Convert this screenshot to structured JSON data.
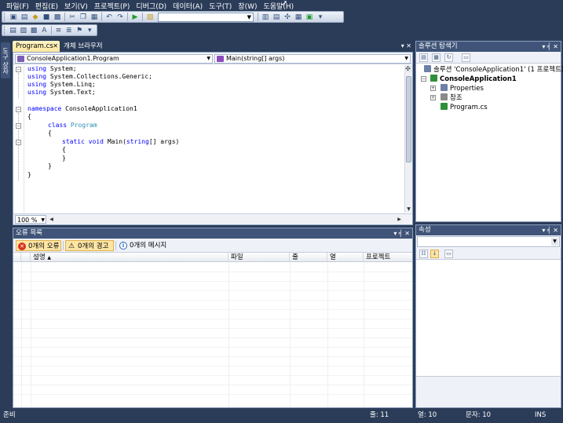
{
  "menu": [
    "파일(F)",
    "편집(E)",
    "보기(V)",
    "프로젝트(P)",
    "디버그(D)",
    "데이터(A)",
    "도구(T)",
    "창(W)",
    "도움말(H)"
  ],
  "toolbar": {
    "config_value": "",
    "icons": [
      "new-project-icon",
      "add-item-icon",
      "open-file-icon",
      "save-icon",
      "save-all-icon",
      "cut-icon",
      "copy-icon",
      "paste-icon",
      "undo-icon",
      "redo-icon",
      "start-debug-icon",
      "find-icon"
    ]
  },
  "left_strip": {
    "toolbox_label": "도구 상자"
  },
  "doc_tabs": {
    "active": "Program.cs",
    "close": "✕",
    "other": "개체 브라우저"
  },
  "nav": {
    "class_combo": "ConsoleApplication1.Program",
    "member_combo": "Main(string[] args)"
  },
  "code": {
    "l1": {
      "kw": "using",
      "rest": " System;"
    },
    "l2": {
      "kw": "using",
      "rest": " System.Collections.Generic;"
    },
    "l3": {
      "kw": "using",
      "rest": " System.Linq;"
    },
    "l4": {
      "kw": "using",
      "rest": " System.Text;"
    },
    "l6": {
      "kw": "namespace",
      "rest": " ConsoleApplication1"
    },
    "l7": "{",
    "l8": {
      "kw": "class",
      "ty": "Program"
    },
    "l9": "{",
    "l10": {
      "kw1": "static",
      "kw2": "void",
      "rest1": " Main(",
      "kw3": "string",
      "rest2": "[] args)"
    },
    "l11": "{",
    "l12": "}",
    "l13": "}",
    "l14": "}"
  },
  "zoom": "100 %",
  "error_list": {
    "title": "오류 목록",
    "errors": "0개의 오류",
    "warnings": "0개의 경고",
    "messages": "0개의 메시지",
    "columns": [
      "설명",
      "파일",
      "줄",
      "열",
      "프로젝트"
    ]
  },
  "solution_explorer": {
    "title": "솔루션 탐색기",
    "solution": "솔루션 'ConsoleApplication1' (1 프로젝트)",
    "project": "ConsoleApplication1",
    "items": [
      "Properties",
      "참조",
      "Program.cs"
    ]
  },
  "properties": {
    "title": "속성"
  },
  "panel_controls": "▾ ╡ ✕",
  "status": {
    "ready": "준비",
    "line": "줄: 11",
    "col": "열: 10",
    "char": "문자: 10",
    "mode": "INS"
  },
  "colors": {
    "keyword": "#0000ff",
    "type": "#2b91af",
    "chrome": "#2b3c59",
    "tab_active": "#ffe8a0"
  }
}
